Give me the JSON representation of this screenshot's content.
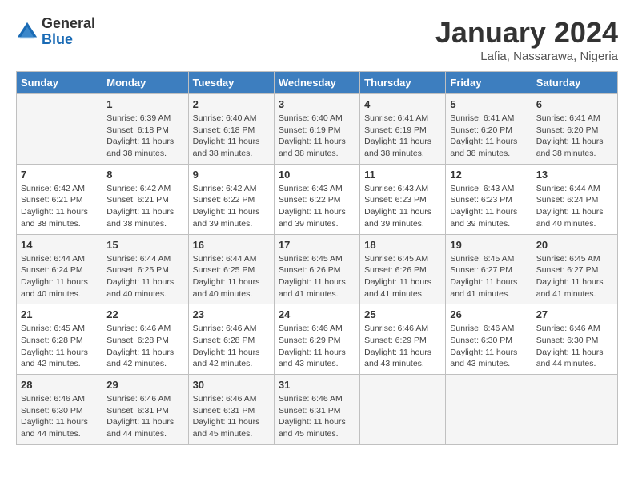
{
  "logo": {
    "general": "General",
    "blue": "Blue"
  },
  "header": {
    "month": "January 2024",
    "location": "Lafia, Nassarawa, Nigeria"
  },
  "days_of_week": [
    "Sunday",
    "Monday",
    "Tuesday",
    "Wednesday",
    "Thursday",
    "Friday",
    "Saturday"
  ],
  "weeks": [
    [
      {
        "day": "",
        "info": ""
      },
      {
        "day": "1",
        "info": "Sunrise: 6:39 AM\nSunset: 6:18 PM\nDaylight: 11 hours and 38 minutes."
      },
      {
        "day": "2",
        "info": "Sunrise: 6:40 AM\nSunset: 6:18 PM\nDaylight: 11 hours and 38 minutes."
      },
      {
        "day": "3",
        "info": "Sunrise: 6:40 AM\nSunset: 6:19 PM\nDaylight: 11 hours and 38 minutes."
      },
      {
        "day": "4",
        "info": "Sunrise: 6:41 AM\nSunset: 6:19 PM\nDaylight: 11 hours and 38 minutes."
      },
      {
        "day": "5",
        "info": "Sunrise: 6:41 AM\nSunset: 6:20 PM\nDaylight: 11 hours and 38 minutes."
      },
      {
        "day": "6",
        "info": "Sunrise: 6:41 AM\nSunset: 6:20 PM\nDaylight: 11 hours and 38 minutes."
      }
    ],
    [
      {
        "day": "7",
        "info": "Sunrise: 6:42 AM\nSunset: 6:21 PM\nDaylight: 11 hours and 38 minutes."
      },
      {
        "day": "8",
        "info": "Sunrise: 6:42 AM\nSunset: 6:21 PM\nDaylight: 11 hours and 38 minutes."
      },
      {
        "day": "9",
        "info": "Sunrise: 6:42 AM\nSunset: 6:22 PM\nDaylight: 11 hours and 39 minutes."
      },
      {
        "day": "10",
        "info": "Sunrise: 6:43 AM\nSunset: 6:22 PM\nDaylight: 11 hours and 39 minutes."
      },
      {
        "day": "11",
        "info": "Sunrise: 6:43 AM\nSunset: 6:23 PM\nDaylight: 11 hours and 39 minutes."
      },
      {
        "day": "12",
        "info": "Sunrise: 6:43 AM\nSunset: 6:23 PM\nDaylight: 11 hours and 39 minutes."
      },
      {
        "day": "13",
        "info": "Sunrise: 6:44 AM\nSunset: 6:24 PM\nDaylight: 11 hours and 40 minutes."
      }
    ],
    [
      {
        "day": "14",
        "info": "Sunrise: 6:44 AM\nSunset: 6:24 PM\nDaylight: 11 hours and 40 minutes."
      },
      {
        "day": "15",
        "info": "Sunrise: 6:44 AM\nSunset: 6:25 PM\nDaylight: 11 hours and 40 minutes."
      },
      {
        "day": "16",
        "info": "Sunrise: 6:44 AM\nSunset: 6:25 PM\nDaylight: 11 hours and 40 minutes."
      },
      {
        "day": "17",
        "info": "Sunrise: 6:45 AM\nSunset: 6:26 PM\nDaylight: 11 hours and 41 minutes."
      },
      {
        "day": "18",
        "info": "Sunrise: 6:45 AM\nSunset: 6:26 PM\nDaylight: 11 hours and 41 minutes."
      },
      {
        "day": "19",
        "info": "Sunrise: 6:45 AM\nSunset: 6:27 PM\nDaylight: 11 hours and 41 minutes."
      },
      {
        "day": "20",
        "info": "Sunrise: 6:45 AM\nSunset: 6:27 PM\nDaylight: 11 hours and 41 minutes."
      }
    ],
    [
      {
        "day": "21",
        "info": "Sunrise: 6:45 AM\nSunset: 6:28 PM\nDaylight: 11 hours and 42 minutes."
      },
      {
        "day": "22",
        "info": "Sunrise: 6:46 AM\nSunset: 6:28 PM\nDaylight: 11 hours and 42 minutes."
      },
      {
        "day": "23",
        "info": "Sunrise: 6:46 AM\nSunset: 6:28 PM\nDaylight: 11 hours and 42 minutes."
      },
      {
        "day": "24",
        "info": "Sunrise: 6:46 AM\nSunset: 6:29 PM\nDaylight: 11 hours and 43 minutes."
      },
      {
        "day": "25",
        "info": "Sunrise: 6:46 AM\nSunset: 6:29 PM\nDaylight: 11 hours and 43 minutes."
      },
      {
        "day": "26",
        "info": "Sunrise: 6:46 AM\nSunset: 6:30 PM\nDaylight: 11 hours and 43 minutes."
      },
      {
        "day": "27",
        "info": "Sunrise: 6:46 AM\nSunset: 6:30 PM\nDaylight: 11 hours and 44 minutes."
      }
    ],
    [
      {
        "day": "28",
        "info": "Sunrise: 6:46 AM\nSunset: 6:30 PM\nDaylight: 11 hours and 44 minutes."
      },
      {
        "day": "29",
        "info": "Sunrise: 6:46 AM\nSunset: 6:31 PM\nDaylight: 11 hours and 44 minutes."
      },
      {
        "day": "30",
        "info": "Sunrise: 6:46 AM\nSunset: 6:31 PM\nDaylight: 11 hours and 45 minutes."
      },
      {
        "day": "31",
        "info": "Sunrise: 6:46 AM\nSunset: 6:31 PM\nDaylight: 11 hours and 45 minutes."
      },
      {
        "day": "",
        "info": ""
      },
      {
        "day": "",
        "info": ""
      },
      {
        "day": "",
        "info": ""
      }
    ]
  ]
}
